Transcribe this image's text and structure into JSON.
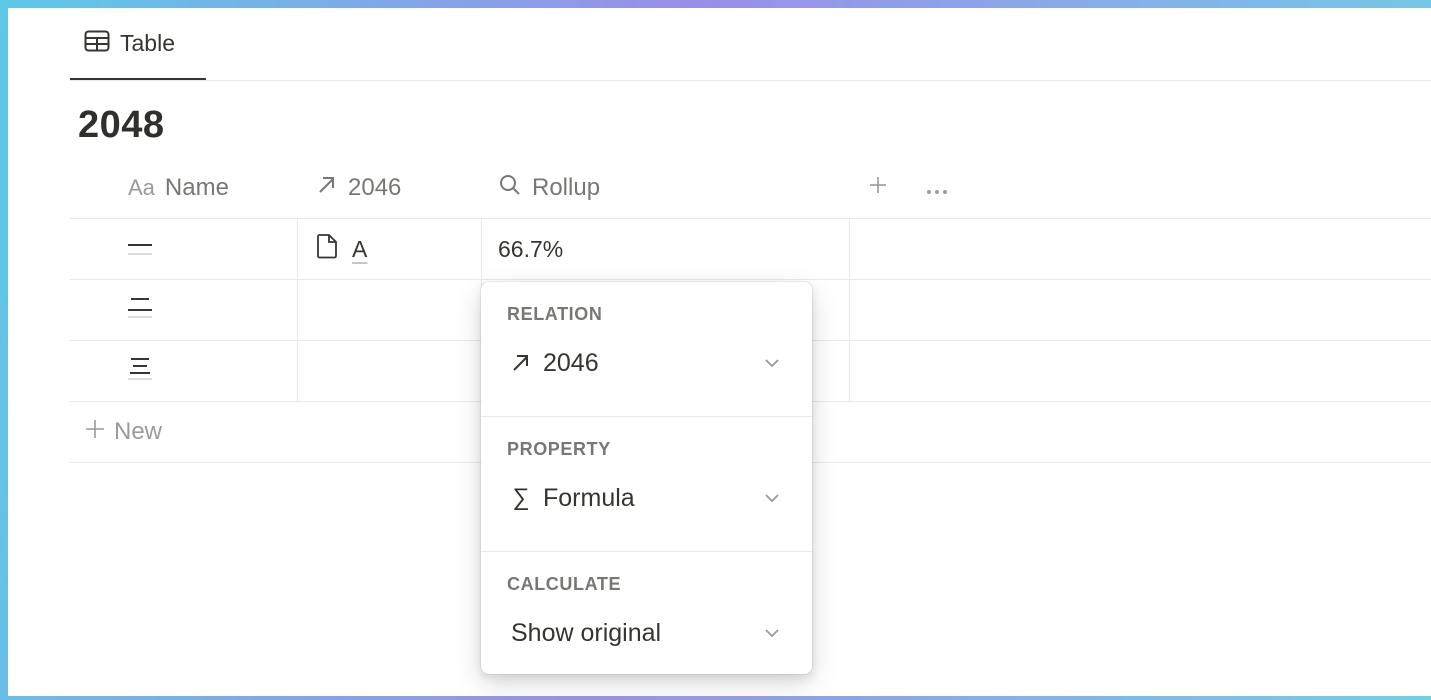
{
  "tab": {
    "label": "Table",
    "icon": "table-icon"
  },
  "database": {
    "title": "2048"
  },
  "columns": {
    "name": {
      "prefix": "Aa",
      "label": "Name"
    },
    "relation": {
      "label": "2046",
      "icon": "arrow-up-right-icon"
    },
    "rollup": {
      "label": "Rollup",
      "icon": "search-icon"
    },
    "add_icon": "plus-icon",
    "more_icon": "more-icon"
  },
  "rows": [
    {
      "name_icon": "one-line-icon",
      "relation": "A",
      "rollup": "66.7%"
    },
    {
      "name_icon": "two-lines-icon",
      "relation": "",
      "rollup": ""
    },
    {
      "name_icon": "three-lines-icon",
      "relation": "",
      "rollup": ""
    }
  ],
  "new_row": {
    "label": "New"
  },
  "popup": {
    "relation": {
      "label": "RELATION",
      "value": "2046"
    },
    "property": {
      "label": "PROPERTY",
      "value": "Formula",
      "icon_glyph": "∑"
    },
    "calculate": {
      "label": "CALCULATE",
      "value": "Show original"
    }
  }
}
